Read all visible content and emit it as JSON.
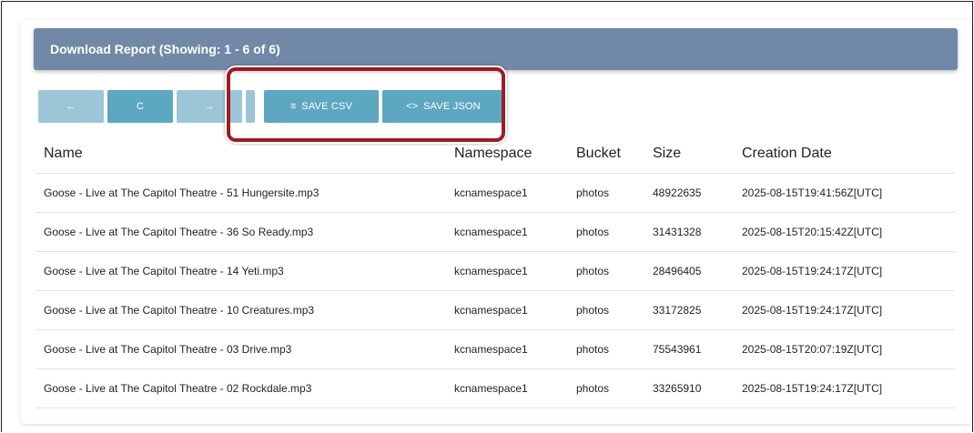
{
  "report": {
    "title": "Download Report (Showing: 1 - 6 of 6)"
  },
  "toolbar": {
    "prev_icon": "←",
    "refresh_icon": "C",
    "next_icon": "→",
    "save_csv_icon": "≡",
    "save_csv_label": "SAVE CSV",
    "save_json_icon": "<>",
    "save_json_label": "SAVE JSON"
  },
  "colors": {
    "header_bg": "#7189a7",
    "button_light": "#9cc6d7",
    "button_dark": "#5da7c1",
    "highlight": "#9e1c23"
  },
  "table": {
    "columns": [
      "Name",
      "Namespace",
      "Bucket",
      "Size",
      "Creation Date"
    ],
    "rows": [
      [
        "Goose - Live at The Capitol Theatre - 51 Hungersite.mp3",
        "kcnamespace1",
        "photos",
        "48922635",
        "2025-08-15T19:41:56Z[UTC]"
      ],
      [
        "Goose - Live at The Capitol Theatre - 36 So Ready.mp3",
        "kcnamespace1",
        "photos",
        "31431328",
        "2025-08-15T20:15:42Z[UTC]"
      ],
      [
        "Goose - Live at The Capitol Theatre - 14 Yeti.mp3",
        "kcnamespace1",
        "photos",
        "28496405",
        "2025-08-15T19:24:17Z[UTC]"
      ],
      [
        "Goose - Live at The Capitol Theatre - 10 Creatures.mp3",
        "kcnamespace1",
        "photos",
        "33172825",
        "2025-08-15T19:24:17Z[UTC]"
      ],
      [
        "Goose - Live at The Capitol Theatre - 03 Drive.mp3",
        "kcnamespace1",
        "photos",
        "75543961",
        "2025-08-15T20:07:19Z[UTC]"
      ],
      [
        "Goose - Live at The Capitol Theatre - 02 Rockdale.mp3",
        "kcnamespace1",
        "photos",
        "33265910",
        "2025-08-15T19:24:17Z[UTC]"
      ]
    ]
  }
}
